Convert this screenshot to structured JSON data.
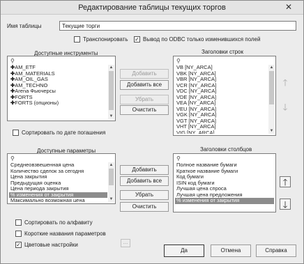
{
  "window": {
    "title": "Редактирование таблицы текущих торгов",
    "close_glyph": "✕"
  },
  "table_name": {
    "label": "Имя таблицы",
    "value": "Текущие торги"
  },
  "options": {
    "transpose": {
      "label": "Транспонировать",
      "checked": false
    },
    "odbc_changed_only": {
      "label": "Вывод по ODBC только изменившихся полей",
      "checked": true
    }
  },
  "instruments": {
    "header": "Доступные инструменты",
    "items": [
      "AM_ETF",
      "AM_MATERIALS",
      "AM_OIL_GAS",
      "AM_TECHNO",
      "Arena Фьючерсы",
      "FORTS",
      "FORTS (опционы)"
    ]
  },
  "row_headers": {
    "header": "Заголовки строк",
    "items": [
      "VB [NY_ARCA]",
      "VBK [NY_ARCA]",
      "VBR [NY_ARCA]",
      "VCR [NY_ARCA]",
      "VDC [NY_ARCA]",
      "VDE [NY_ARCA]",
      "VEA [NY_ARCA]",
      "VEU [NY_ARCA]",
      "VGK [NY_ARCA]",
      "VGT [NY_ARCA]",
      "VHT [NY_ARCA]",
      "VIG [NY_ARCA]"
    ]
  },
  "instr_buttons": {
    "add": "Добавить",
    "add_all": "Добавить все",
    "remove": "Убрать",
    "clear": "Очистить"
  },
  "sort_expiry": {
    "label": "Сортировать по дате погашения",
    "checked": false
  },
  "params": {
    "header": "Доступные параметры",
    "items": [
      "Среднеовзвешенная цена",
      "Количество сделок за сегодня",
      "Цена закрытия",
      "Предыдущая оценка",
      "Цена периода закрытия",
      "% изменения от закрытия",
      "Максимально возможная цена"
    ],
    "selected_index": 5
  },
  "col_headers": {
    "header": "Заголовки столбцов",
    "items": [
      "Полное название бумаги",
      "Краткое название бумаги",
      "Код бумаги",
      "ISIN код бумаги",
      "Лучшая цена спроса",
      "Лучшая цена предложения",
      "% изменения от закрытия"
    ],
    "selected_index": 6
  },
  "param_buttons": {
    "add": "Добавить",
    "add_all": "Добавить все",
    "remove": "Убрать",
    "clear": "Очистить"
  },
  "sort_alpha": {
    "label": "Сортировать по алфавиту",
    "checked": false
  },
  "short_names": {
    "label": "Короткие названия параметров",
    "checked": false
  },
  "color_settings": {
    "label": "Цветовые настройки",
    "checked": true,
    "more_label": "..."
  },
  "footer": {
    "ok": "Да",
    "cancel": "Отмена",
    "help": "Справка"
  },
  "icons": {
    "search": "⚲",
    "up_arrow": "🡑",
    "down_arrow": "🡓",
    "check": "✓",
    "plus": "✚"
  }
}
